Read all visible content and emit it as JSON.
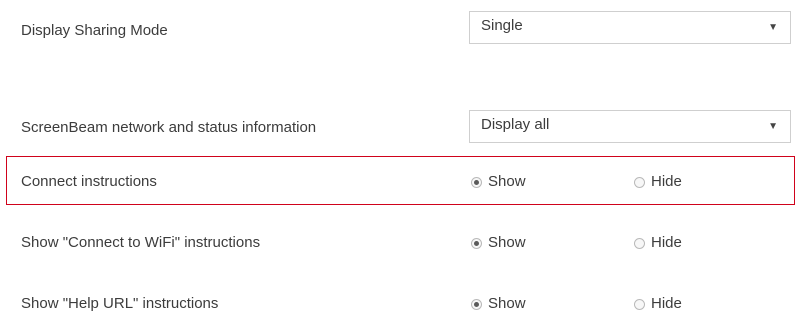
{
  "display_sharing": {
    "label": "Display Sharing Mode",
    "selected": "Single"
  },
  "network_info": {
    "label": "ScreenBeam network and status information",
    "selected": "Display all"
  },
  "rows": [
    {
      "label": "Connect instructions",
      "show": "Show",
      "hide": "Hide",
      "selected": "Show"
    },
    {
      "label": "Show \"Connect to WiFi\" instructions",
      "show": "Show",
      "hide": "Hide",
      "selected": "Show"
    },
    {
      "label": "Show \"Help URL\" instructions",
      "show": "Show",
      "hide": "Hide",
      "selected": "Show"
    }
  ],
  "colors": {
    "highlight_border": "#d0021b",
    "text": "#3c3c3c"
  }
}
